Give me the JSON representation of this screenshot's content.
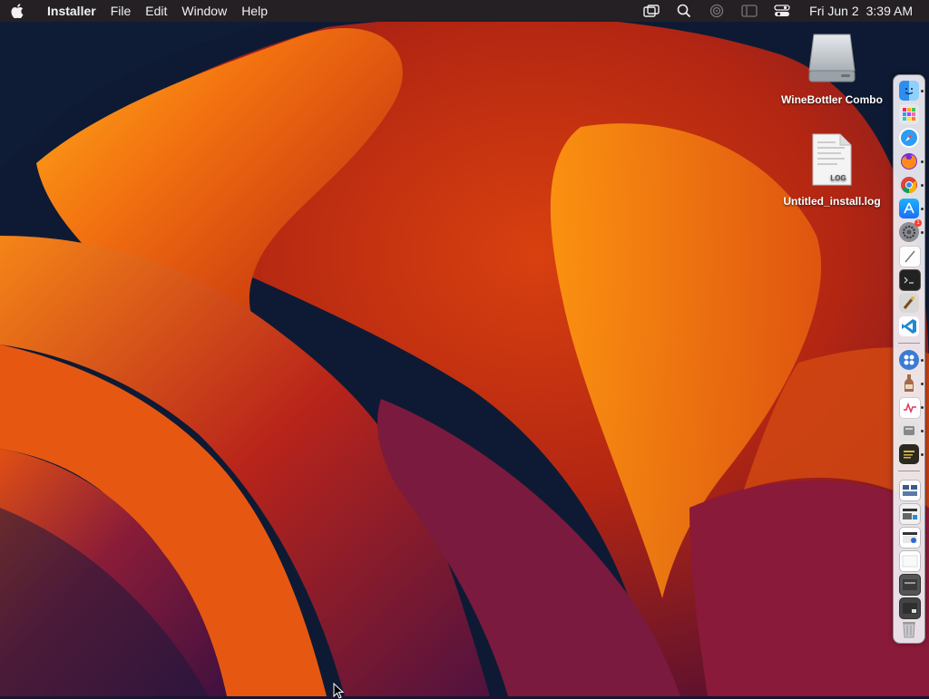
{
  "menubar": {
    "app_name": "Installer",
    "menus": [
      "File",
      "Edit",
      "Window",
      "Help"
    ],
    "status_icons": [
      "screen-mirroring-icon",
      "search-icon",
      "airplay-icon",
      "display-icon",
      "control-center-icon"
    ],
    "date": "Fri Jun 2",
    "time": "3:39 AM"
  },
  "desktop": {
    "icons": [
      {
        "label": "WineBottler Combo",
        "icon": "disk-image-icon"
      },
      {
        "label": "Untitled_install.log",
        "icon": "log-file-icon",
        "badge": "LOG"
      }
    ]
  },
  "dock": {
    "apps": [
      {
        "icon": "finder-icon",
        "running": true
      },
      {
        "icon": "launchpad-icon",
        "running": false
      },
      {
        "icon": "safari-icon",
        "running": false
      },
      {
        "icon": "firefox-icon",
        "running": true
      },
      {
        "icon": "chrome-icon",
        "running": true
      },
      {
        "icon": "app-store-icon",
        "running": true
      },
      {
        "icon": "system-settings-icon",
        "running": true,
        "badge": "1"
      },
      {
        "icon": "textedit-icon",
        "running": false
      },
      {
        "icon": "terminal-icon",
        "running": false
      },
      {
        "icon": "script-editor-icon",
        "running": false
      },
      {
        "icon": "vscode-icon",
        "running": false
      }
    ],
    "recent_apps": [
      {
        "icon": "installer-icon",
        "running": true
      },
      {
        "icon": "winebottler-icon",
        "running": true
      },
      {
        "icon": "activity-monitor-icon",
        "running": true
      },
      {
        "icon": "disk-utility-icon",
        "running": true
      },
      {
        "icon": "console-icon",
        "running": true
      }
    ],
    "stack_items": [
      {
        "icon": "window-thumbnail-icon"
      },
      {
        "icon": "window-thumbnail-icon"
      },
      {
        "icon": "window-thumbnail-icon"
      },
      {
        "icon": "document-thumbnail-icon"
      },
      {
        "icon": "window-thumbnail-icon"
      },
      {
        "icon": "window-thumbnail-icon"
      },
      {
        "icon": "trash-icon"
      }
    ]
  },
  "colors": {
    "menubar_bg": "#242024",
    "wallpaper_orange": "#f07010",
    "wallpaper_red": "#c22a10",
    "wallpaper_purple": "#6a1a48",
    "wallpaper_dark": "#0e1a33"
  }
}
